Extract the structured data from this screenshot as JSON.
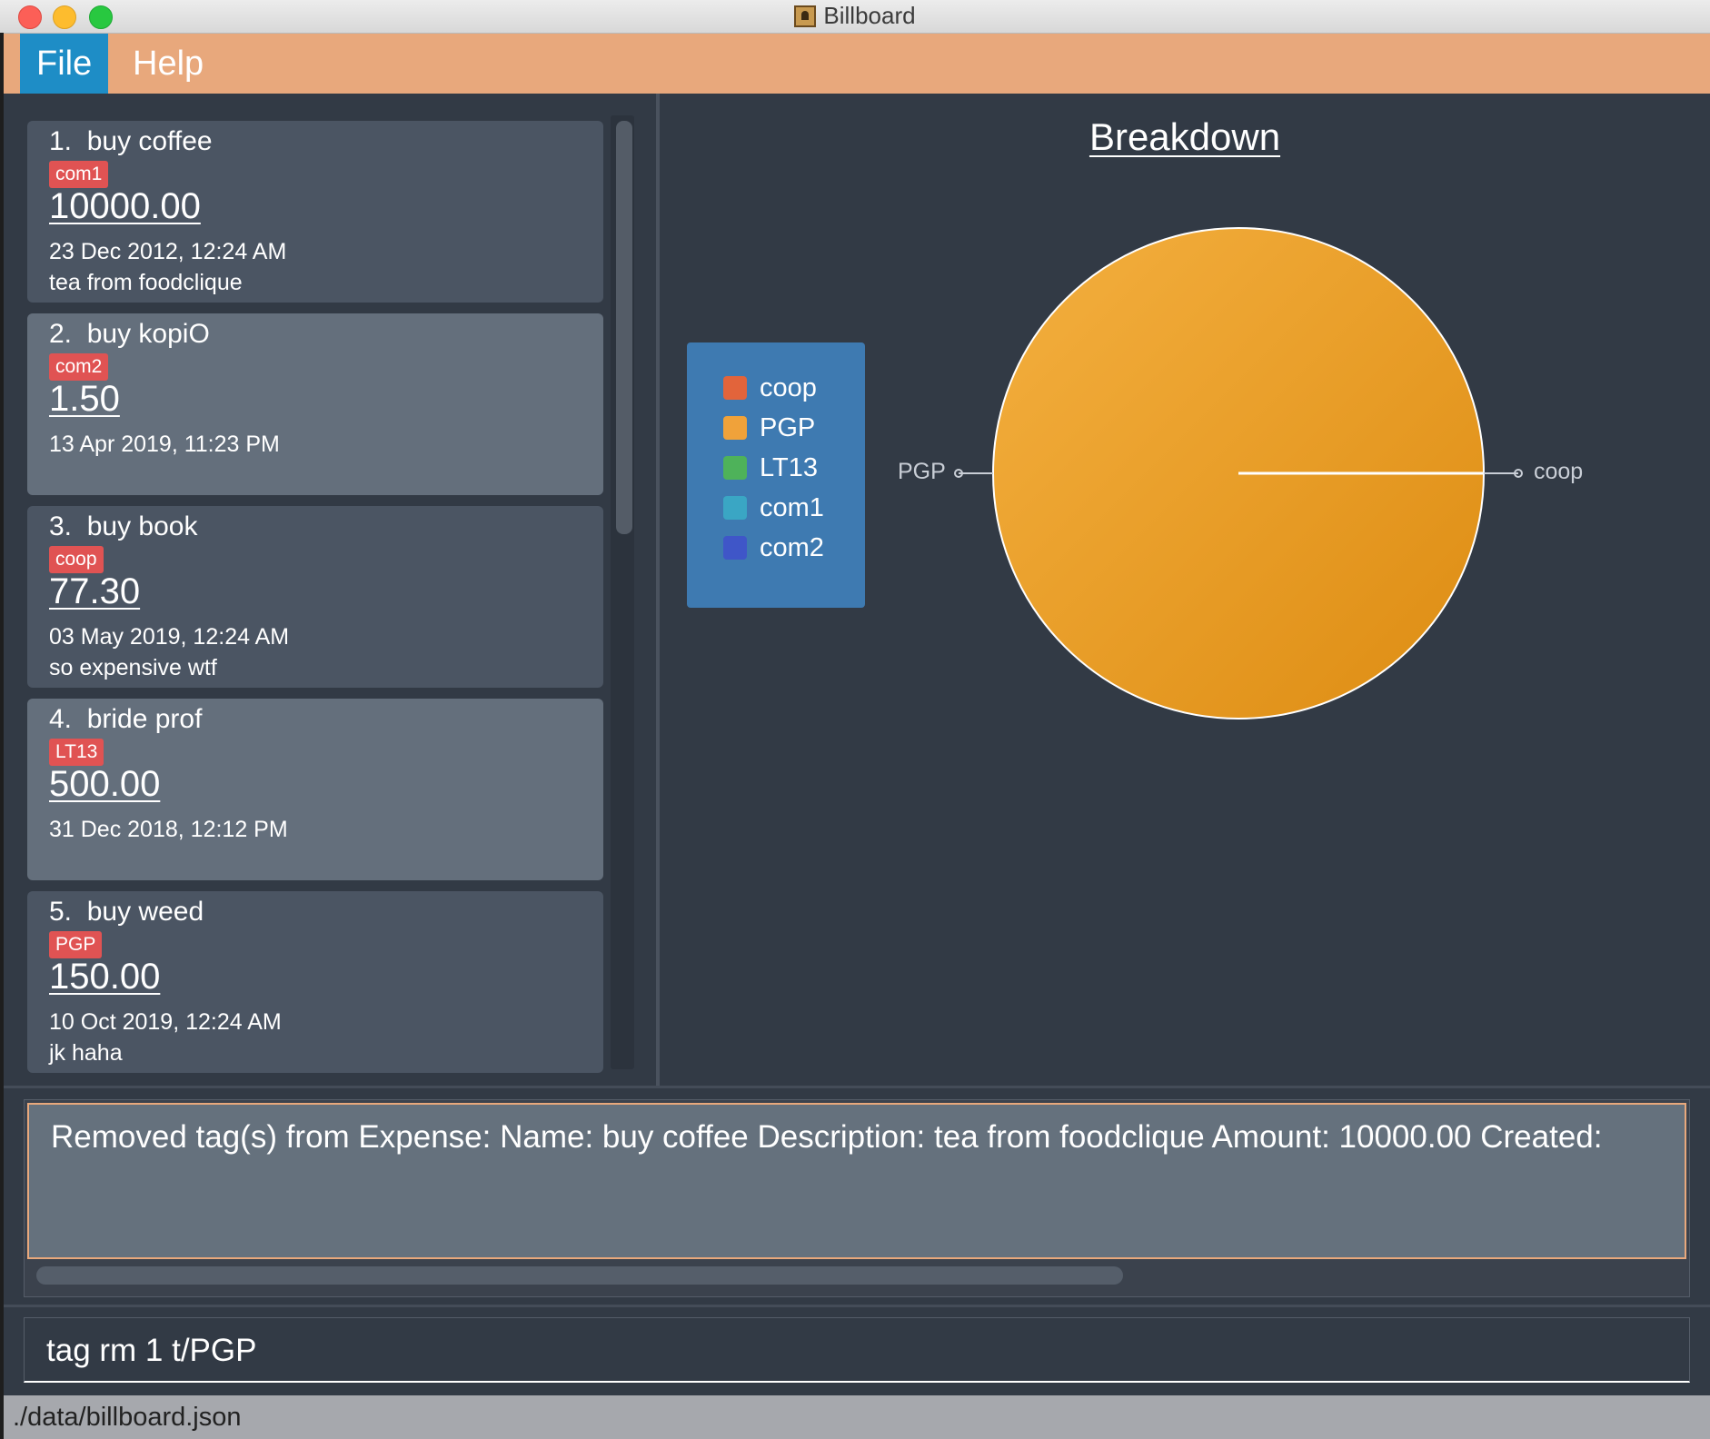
{
  "window": {
    "title": "Billboard"
  },
  "menu": {
    "file": "File",
    "help": "Help"
  },
  "expenses": [
    {
      "index": "1.",
      "name": "buy coffee",
      "tag": "com1",
      "amount": "10000.00",
      "date": "23 Dec 2012, 12:24 AM",
      "description": "tea from foodclique"
    },
    {
      "index": "2.",
      "name": "buy kopiO",
      "tag": "com2",
      "amount": "1.50",
      "date": "13 Apr 2019, 11:23 PM",
      "description": ""
    },
    {
      "index": "3.",
      "name": "buy book",
      "tag": "coop",
      "amount": "77.30",
      "date": "03 May 2019, 12:24 AM",
      "description": "so expensive wtf"
    },
    {
      "index": "4.",
      "name": "bride prof",
      "tag": "LT13",
      "amount": "500.00",
      "date": "31 Dec 2018, 12:12 PM",
      "description": ""
    },
    {
      "index": "5.",
      "name": "buy weed",
      "tag": "PGP",
      "amount": "150.00",
      "date": "10 Oct 2019, 12:24 AM",
      "description": "jk haha"
    }
  ],
  "chart_data": {
    "type": "pie",
    "title": "Breakdown",
    "labels": [
      "coop",
      "PGP",
      "LT13",
      "com1",
      "com2"
    ],
    "values": [
      0,
      1,
      0,
      0,
      0
    ],
    "colors": [
      "#e2643b",
      "#f0a23a",
      "#4eb25a",
      "#3aa6c4",
      "#3f56c8"
    ],
    "slice_labels_shown": [
      "PGP",
      "coop"
    ],
    "legend_position": "left"
  },
  "result": {
    "text": "Removed tag(s) from Expense: Name: buy coffee Description: tea from foodclique Amount: 10000.00 Created:"
  },
  "command": {
    "value": "tag rm 1 t/PGP"
  },
  "status": {
    "path": "./data/billboard.json"
  }
}
